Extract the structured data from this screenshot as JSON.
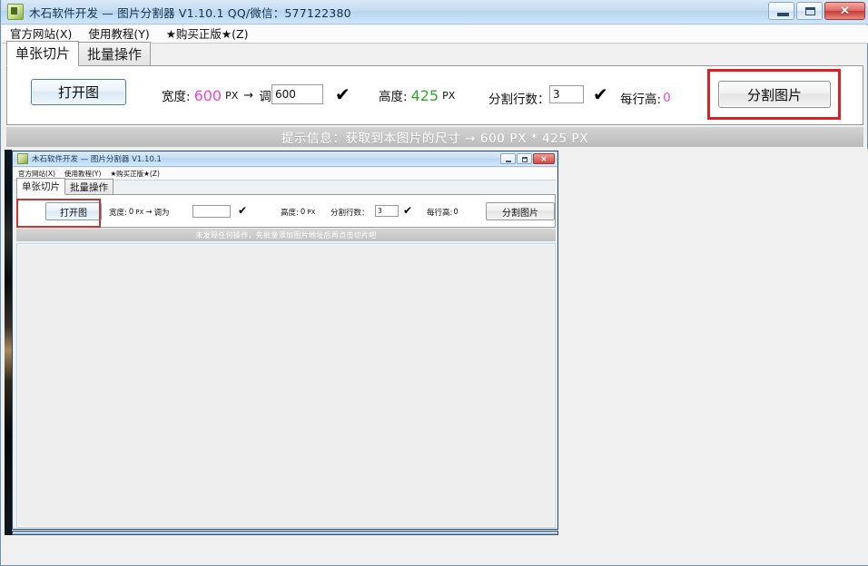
{
  "window": {
    "title": "木石软件开发 — 图片分割器 V1.10.1    QQ/微信：577122380",
    "icon": "app-icon",
    "buttons": {
      "minimize": "–",
      "maximize": "□",
      "close": "✕"
    }
  },
  "menubar": {
    "items": [
      {
        "label": "官方网站(X)"
      },
      {
        "label": "使用教程(Y)"
      },
      {
        "label": "★购买正版★(Z)"
      }
    ]
  },
  "tabs": [
    {
      "label": "单张切片",
      "active": true
    },
    {
      "label": "批量操作",
      "active": false
    }
  ],
  "toolbar": {
    "open_button": "打开图",
    "width_label": "宽度:",
    "width_value": "600",
    "width_unit": "PX",
    "arrow": "→",
    "adjust_label": "调为",
    "adjust_value": "600",
    "check1": "✔",
    "height_label": "高度:",
    "height_value": "425",
    "height_unit": "PX",
    "rows_label": "分割行数：",
    "rows_value": "3",
    "check2": "✔",
    "rowheight_label": "每行高:",
    "rowheight_value": "0",
    "split_button": "分割图片"
  },
  "status": {
    "message": "提示信息：获取到本图片的尺寸 → 600 PX * 425 PX"
  },
  "highlights": {
    "split_button_box": "red-highlight",
    "inner_open_button_box": "red-highlight"
  },
  "nested_screenshot": {
    "window": {
      "title": "木石软件开发 — 图片分割器 V1.10.1",
      "buttons": {
        "minimize": "–",
        "maximize": "□",
        "close": "✕"
      }
    },
    "menubar": {
      "items": [
        {
          "label": "官方网站(X)"
        },
        {
          "label": "使用教程(Y)"
        },
        {
          "label": "★购买正版★(Z)"
        }
      ]
    },
    "tabs": [
      {
        "label": "单张切片",
        "active": true
      },
      {
        "label": "批量操作",
        "active": false
      }
    ],
    "toolbar": {
      "open_button": "打开图",
      "width_label": "宽度:",
      "width_value": "0",
      "width_unit": "PX",
      "arrow": "→",
      "adjust_label": "调为",
      "adjust_value": "",
      "check1": "✔",
      "height_label": "高度:",
      "height_value": "0",
      "height_unit": "PX",
      "rows_label": "分割行数：",
      "rows_value": "3",
      "check2": "✔",
      "rowheight_label": "每行高:",
      "rowheight_value": "0",
      "split_button": "分割图片"
    },
    "status": {
      "message": "未发现任何操作，先批量添加图片地址后再点击切片吧"
    }
  },
  "colors": {
    "accent_pink": "#ff3fd0",
    "accent_green": "#2ea82e",
    "highlight_red": "#e02020",
    "titlebar_blue": "#c5ddf2",
    "status_gray": "#c7c7c7"
  }
}
